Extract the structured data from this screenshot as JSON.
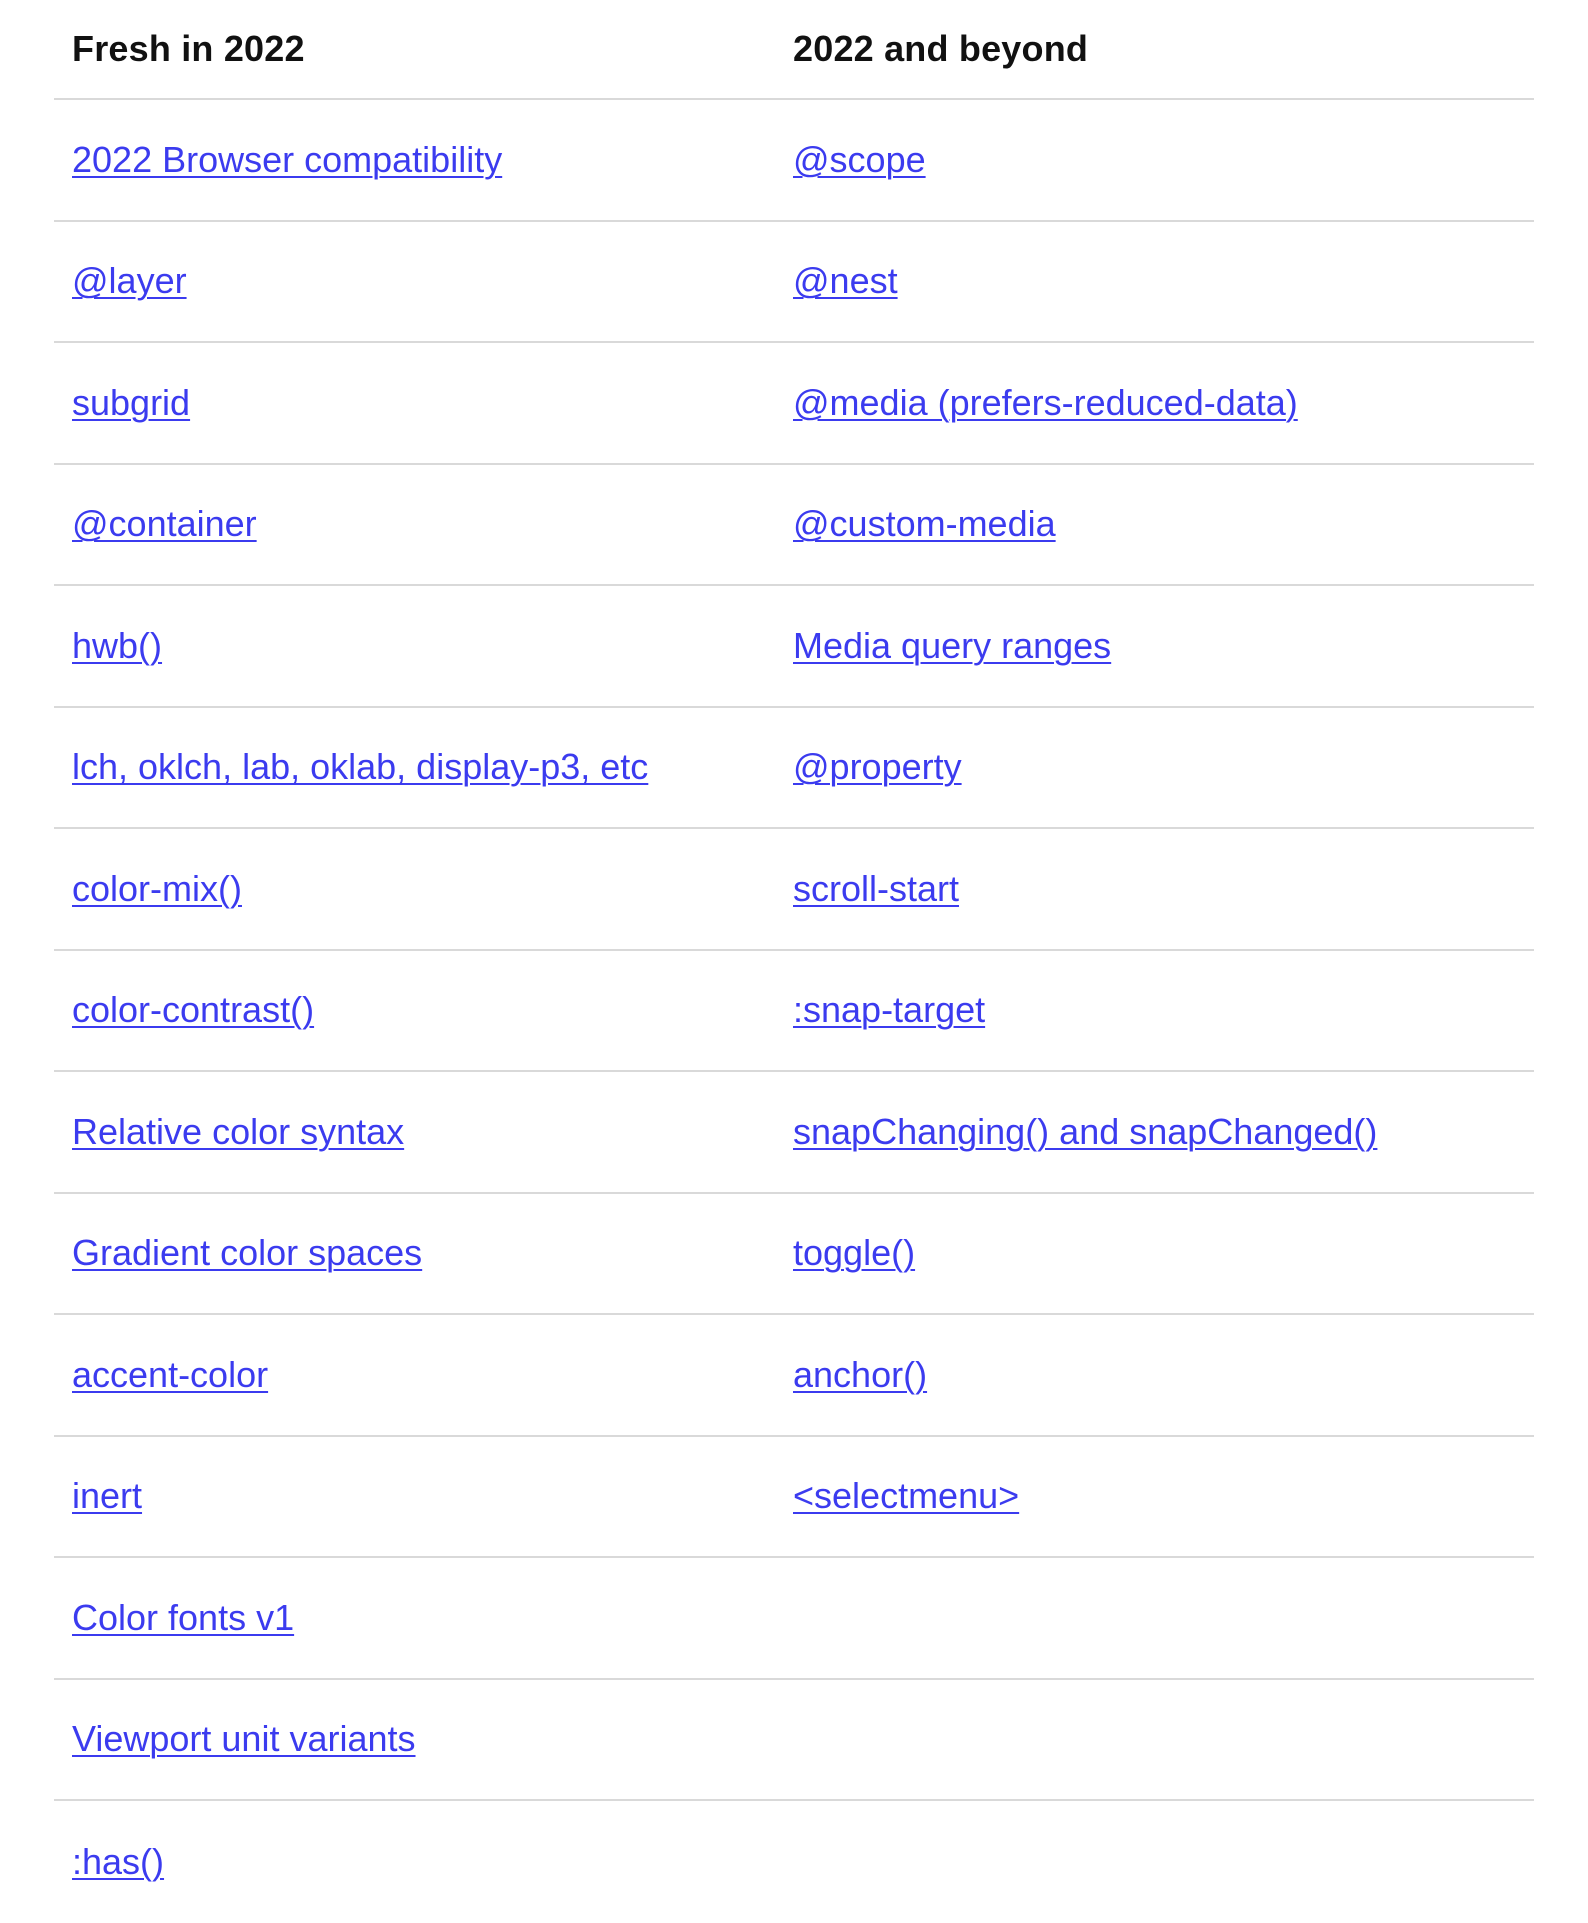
{
  "table": {
    "headers": [
      "Fresh in 2022",
      "2022 and beyond"
    ],
    "rows": [
      [
        "2022 Browser compatibility",
        "@scope"
      ],
      [
        "@layer",
        "@nest"
      ],
      [
        "subgrid",
        "@media (prefers-reduced-data)"
      ],
      [
        "@container",
        "@custom-media"
      ],
      [
        "hwb()",
        "Media query ranges"
      ],
      [
        "lch, oklch, lab, oklab, display-p3, etc",
        "@property"
      ],
      [
        "color-mix()",
        "scroll-start"
      ],
      [
        "color-contrast()",
        ":snap-target"
      ],
      [
        "Relative color syntax",
        "snapChanging() and snapChanged()"
      ],
      [
        "Gradient color spaces",
        "toggle()"
      ],
      [
        "accent-color",
        "anchor()"
      ],
      [
        "inert",
        "<selectmenu>"
      ],
      [
        "Color fonts v1",
        ""
      ],
      [
        "Viewport unit variants",
        ""
      ],
      [
        ":has()",
        ""
      ]
    ]
  },
  "colors": {
    "link": "#3b3bef",
    "header_text": "#111111",
    "divider": "#d9d9d9"
  }
}
